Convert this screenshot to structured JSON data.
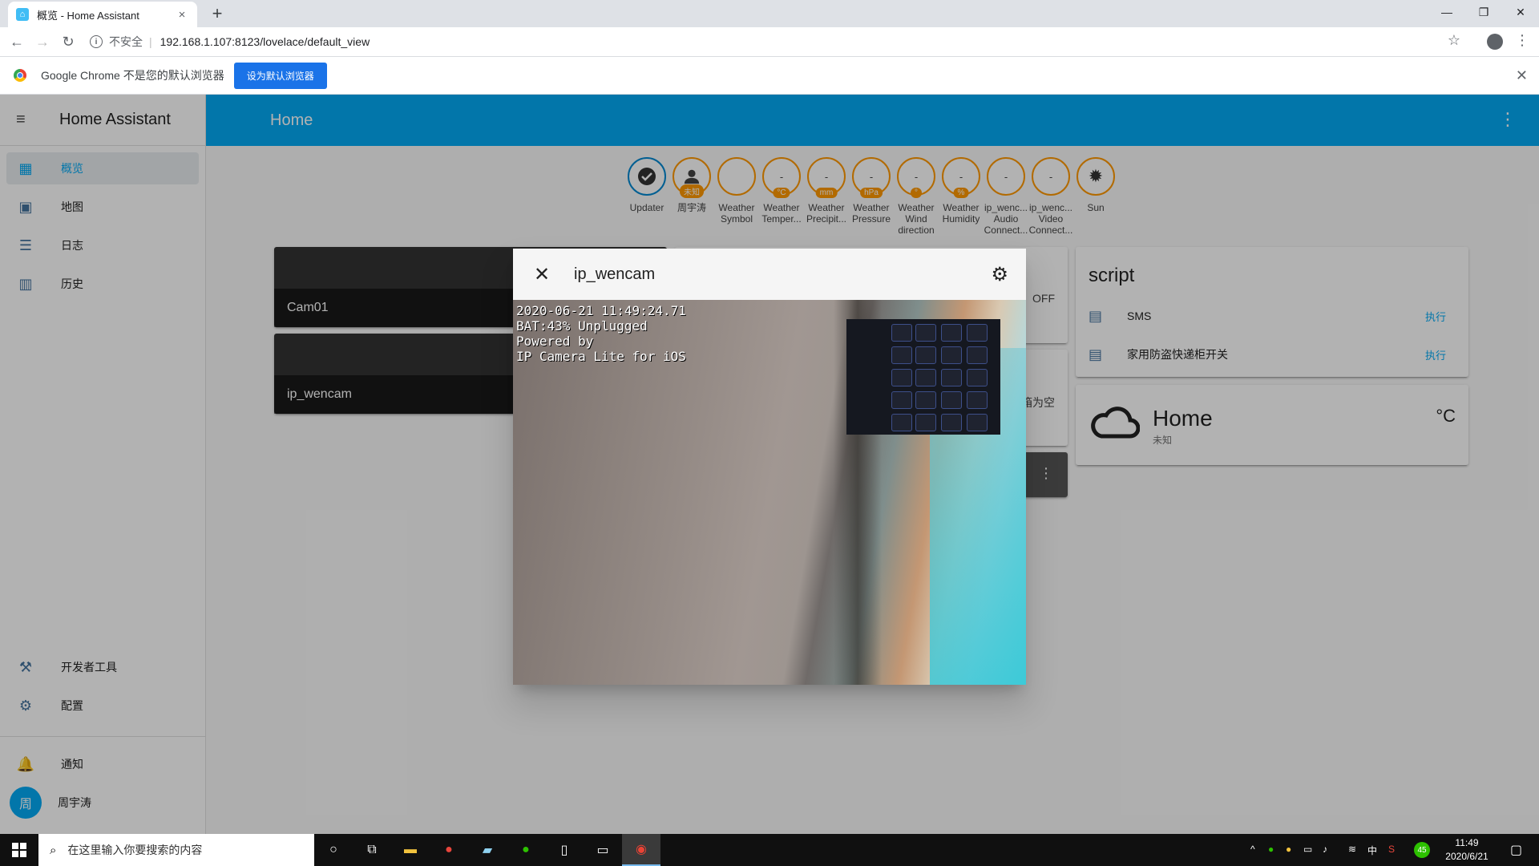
{
  "browser": {
    "tab_title": "概览 - Home Assistant",
    "tab_close": "×",
    "new_tab": "+",
    "insecure_label": "不安全",
    "url": "192.168.1.107:8123/lovelace/default_view",
    "window_controls": [
      "—",
      "❐",
      "✕"
    ]
  },
  "infobar": {
    "message": "Google Chrome 不是您的默认浏览器",
    "button": "设为默认浏览器"
  },
  "sidebar": {
    "title": "Home Assistant",
    "items": [
      {
        "label": "概览",
        "icon": "dashboard-icon",
        "active": true
      },
      {
        "label": "地图",
        "icon": "map-account-icon"
      },
      {
        "label": "日志",
        "icon": "logbook-icon"
      },
      {
        "label": "历史",
        "icon": "history-chart-icon"
      }
    ],
    "bottom_items": [
      {
        "label": "开发者工具",
        "icon": "hammer-icon"
      },
      {
        "label": "配置",
        "icon": "cog-icon"
      }
    ],
    "notifications_label": "通知",
    "user_initial": "周",
    "user_name": "周宇涛"
  },
  "header": {
    "view_title": "Home"
  },
  "badges": [
    {
      "label": "Updater",
      "value": "",
      "unit": ""
    },
    {
      "label": "周宇涛",
      "value": "",
      "unit": "未知"
    },
    {
      "label": "Weather Symbol",
      "value": "",
      "unit": ""
    },
    {
      "label": "Weather Temper...",
      "value": "-",
      "unit": "°C"
    },
    {
      "label": "Weather Precipit...",
      "value": "-",
      "unit": "mm"
    },
    {
      "label": "Weather Pressure",
      "value": "-",
      "unit": "hPa"
    },
    {
      "label": "Weather Wind direction",
      "value": "-",
      "unit": "°"
    },
    {
      "label": "Weather Humidity",
      "value": "-",
      "unit": "%"
    },
    {
      "label": "ip_wenc... Audio Connect...",
      "value": "-",
      "unit": ""
    },
    {
      "label": "ip_wenc... Video Connect...",
      "value": "-",
      "unit": ""
    },
    {
      "label": "Sun",
      "value": "",
      "unit": ""
    }
  ],
  "cameras": [
    {
      "name": "Cam01"
    },
    {
      "name": "ip_wencam"
    }
  ],
  "partial_card": {
    "off_label": "OFF",
    "empty_text": "箱为空"
  },
  "script_card": {
    "title": "script",
    "rows": [
      {
        "name": "SMS",
        "action": "执行"
      },
      {
        "name": "家用防盗快递柜开关",
        "action": "执行"
      }
    ]
  },
  "weather_card": {
    "name": "Home",
    "state": "未知",
    "unit": "°C"
  },
  "dialog": {
    "title": "ip_wencam",
    "osd_line1": "2020-06-21 11:49:24.71",
    "osd_line2": "BAT:43% Unplugged",
    "osd_line3": "Powered by",
    "osd_line4": "IP Camera Lite for iOS"
  },
  "taskbar": {
    "search_placeholder": "在这里输入你要搜索的内容",
    "ime": "中",
    "badge_number": "45",
    "time": "11:49",
    "date": "2020/6/21"
  }
}
